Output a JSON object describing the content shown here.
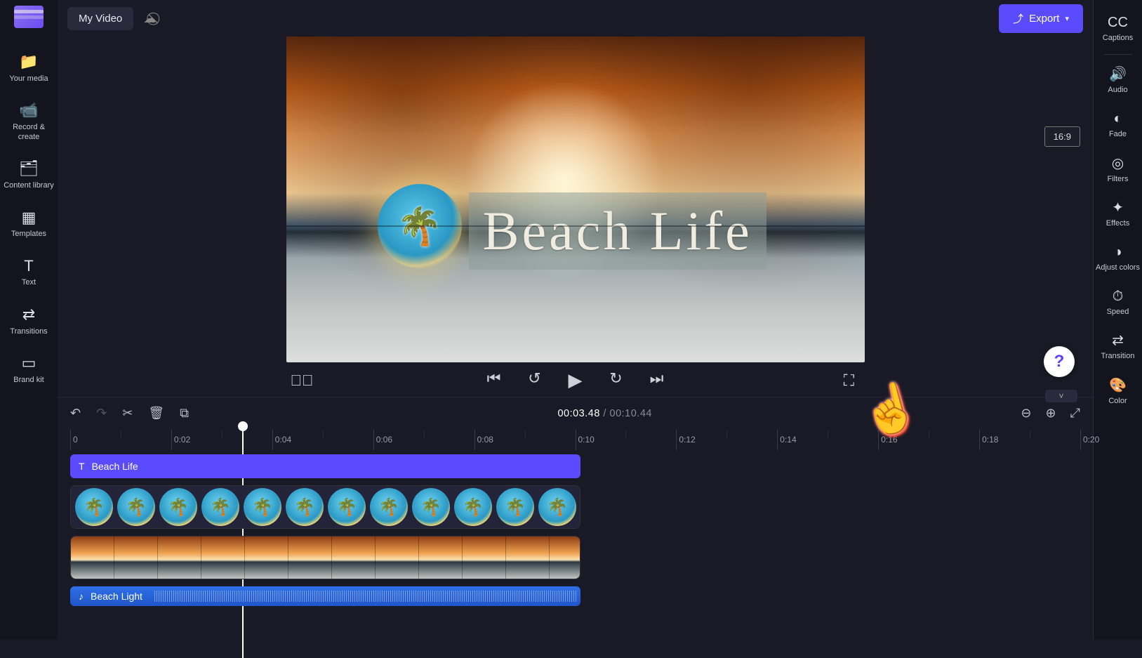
{
  "header": {
    "project_title": "My Video",
    "export_label": "Export",
    "aspect_ratio": "16:9"
  },
  "left_nav": [
    {
      "id": "your-media",
      "label": "Your media",
      "icon": "📁"
    },
    {
      "id": "record-create",
      "label": "Record & create",
      "icon": "📹"
    },
    {
      "id": "content-library",
      "label": "Content library",
      "icon": "🗂"
    },
    {
      "id": "templates",
      "label": "Templates",
      "icon": "▦"
    },
    {
      "id": "text",
      "label": "Text",
      "icon": "T"
    },
    {
      "id": "transitions",
      "label": "Transitions",
      "icon": "⇄"
    },
    {
      "id": "brand-kit",
      "label": "Brand kit",
      "icon": "▭"
    }
  ],
  "right_nav": [
    {
      "id": "captions",
      "label": "Captions",
      "icon": "CC"
    },
    {
      "id": "audio",
      "label": "Audio",
      "icon": "🔊"
    },
    {
      "id": "fade",
      "label": "Fade",
      "icon": "◐"
    },
    {
      "id": "filters",
      "label": "Filters",
      "icon": "◎"
    },
    {
      "id": "effects",
      "label": "Effects",
      "icon": "✦"
    },
    {
      "id": "adjust-colors",
      "label": "Adjust colors",
      "icon": "◑"
    },
    {
      "id": "speed",
      "label": "Speed",
      "icon": "⏱"
    },
    {
      "id": "transition",
      "label": "Transition",
      "icon": "⇄"
    },
    {
      "id": "color",
      "label": "Color",
      "icon": "🎨"
    }
  ],
  "preview": {
    "overlay_title": "Beach Life"
  },
  "playback": {
    "current_time": "00:03.48",
    "separator": " / ",
    "total_time": "00:10.44"
  },
  "ruler": {
    "ticks": [
      "0",
      "0:02",
      "0:04",
      "0:06",
      "0:08",
      "0:10",
      "0:12",
      "0:14",
      "0:16",
      "0:18",
      "0:20"
    ],
    "playhead_percent": 17.0
  },
  "tracks": {
    "track_end_percent": 50.5,
    "text_track_label": "Beach Life",
    "audio_track_label": "Beach Light",
    "thumb_count": 12,
    "vframe_count": 12
  },
  "help_symbol": "?"
}
